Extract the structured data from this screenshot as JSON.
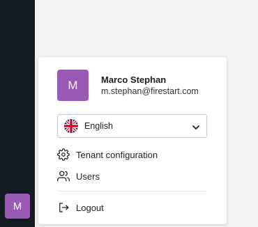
{
  "user": {
    "initial": "M",
    "name": "Marco Stephan",
    "email": "m.stephan@firestart.com",
    "avatar_color": "#9b59b6"
  },
  "language": {
    "selected": "English",
    "flag_icon": "uk-flag-icon"
  },
  "menu": {
    "items": [
      {
        "label": "Tenant configuration",
        "icon": "gear-icon"
      },
      {
        "label": "Users",
        "icon": "users-icon"
      }
    ],
    "logout": {
      "label": "Logout",
      "icon": "logout-icon"
    }
  },
  "colors": {
    "sidebar": "#151b22",
    "background": "#f2f2f2"
  }
}
